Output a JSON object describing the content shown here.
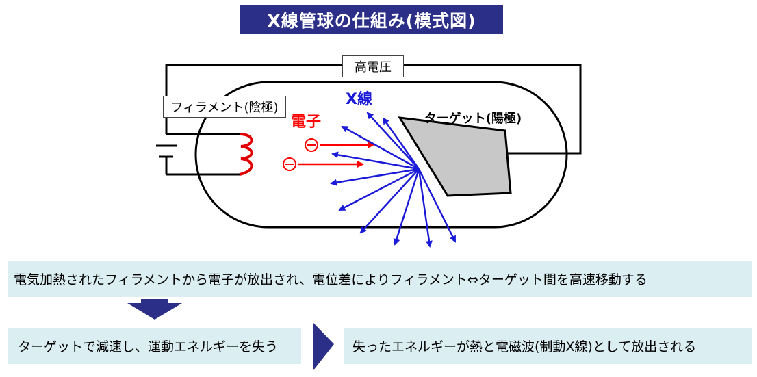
{
  "title": "X線管球の仕組み(模式図)",
  "labels": {
    "high_voltage": "高電圧",
    "filament": "フィラメント(陰極)",
    "target": "ターゲット(陽極)",
    "electron": "電子",
    "xray": "X線"
  },
  "colors": {
    "title_bg": "#2b2f88",
    "electron": "#ff0000",
    "xray": "#1a1ad8",
    "band_bg": "#dbeef2",
    "arrow": "#2b2f88",
    "target_fill": "#c8c8c8"
  },
  "steps": [
    "電気加熱されたフィラメントから電子が放出され、電位差によりフィラメント⇔ターゲット間を高速移動する",
    "ターゲットで減速し、運動エネルギーを失う",
    "失ったエネルギーが熱と電磁波(制動X線)として放出される"
  ]
}
